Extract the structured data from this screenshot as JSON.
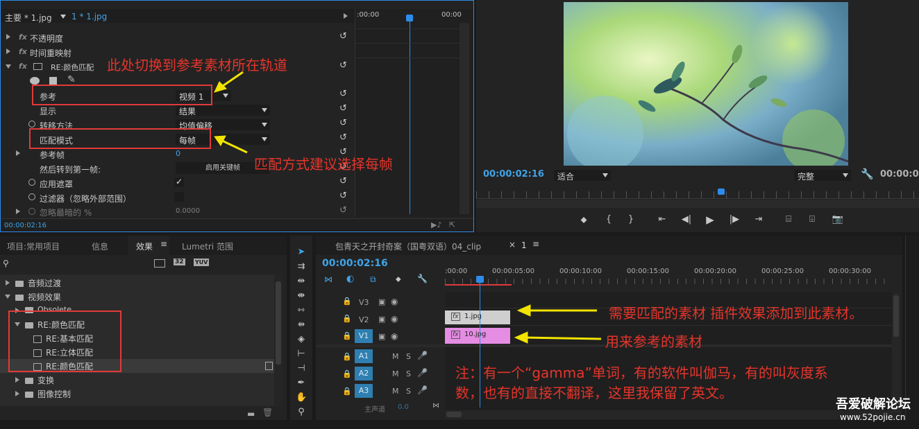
{
  "effect_controls": {
    "tab_master": "主要 * 1.jpg",
    "tab_clip": "1 * 1.jpg",
    "mini_ruler_start": ":00:00",
    "mini_ruler_end": "00:00",
    "rows": {
      "opacity": "不透明度",
      "time_remap": "时间重映射",
      "re_color_match": "RE:颜色匹配",
      "reference_label": "参考",
      "reference_value": "视频 1",
      "display_label": "显示",
      "display_value": "结果",
      "transfer_label": "转移方法",
      "transfer_value": "均值偏移",
      "match_mode_label": "匹配模式",
      "match_mode_value": "每帧",
      "ref_frame_label": "参考帧",
      "ref_frame_value": "0",
      "then_goto_label": "然后转到第一帧:",
      "then_goto_button": "启用关键帧",
      "apply_mask_label": "应用遮罩",
      "apply_mask_check": "✓",
      "filter_label": "过滤器（忽略外部范围）",
      "ignore_label": "忽略最暗的 %",
      "ignore_value": "0.0000"
    },
    "timecode": "00:00:02:16"
  },
  "program_monitor": {
    "timecode": "00:00:02:16",
    "zoom": "适合",
    "quality": "完整",
    "duration": "00:00:0"
  },
  "effects_panel": {
    "tabs": [
      "项目:常用项目",
      "信息",
      "效果",
      "Lumetri 范围"
    ],
    "menu_glyph": "≡",
    "badges": [
      "32",
      "YUV"
    ],
    "tree": {
      "audio_transitions": "音频过渡",
      "video_effects": "视频效果",
      "obsolete": "Obsolete",
      "re_color_match": "RE:颜色匹配",
      "basic_match": "RE:基本匹配",
      "volume_match": "RE:立体匹配",
      "color_match": "RE:颜色匹配",
      "transform": "变换",
      "image_control": "图像控制"
    }
  },
  "timeline": {
    "tab": "包青天之开封奇案（国粤双语）04_clip",
    "tab_close": "×",
    "tab_two": "1",
    "menu_glyph": "≡",
    "timecode": "00:00:02:16",
    "ruler": [
      ":00:00",
      "00:00:05:00",
      "00:00:10:00",
      "00:00:15:00",
      "00:00:20:00",
      "00:00:25:00",
      "00:00:30:00"
    ],
    "video_tracks": [
      "V3",
      "V2",
      "V1"
    ],
    "audio_tracks": [
      "A1",
      "A2",
      "A3"
    ],
    "audio_letters": [
      "M",
      "S"
    ],
    "clip_v2": "1.jpg",
    "clip_v1": "10.jpg",
    "fx_badge": "fx",
    "master_label": "主声道",
    "master_value": "0.0"
  },
  "annotations": {
    "switch_track": "此处切换到参考素材所在轨道",
    "match_mode_tip": "匹配方式建议选择每帧",
    "clip_to_match": "需要匹配的素材 插件效果添加到此素材。",
    "reference_clip": "用来参考的素材",
    "note_line1": "注：有一个“gamma”单词，有的软件叫伽马，有的叫灰度系",
    "note_line2": "数，也有的直接不翻译，这里我保留了英文。"
  },
  "watermark": {
    "site": "吾爱破解论坛",
    "url": "www.52pojie.cn"
  },
  "colors": {
    "accent_blue": "#2d8ceb",
    "annotation_red": "#e5352b",
    "arrow_yellow": "#f2e400",
    "clip_v2": "#cfcfcf",
    "clip_v1": "#e58ce3"
  }
}
